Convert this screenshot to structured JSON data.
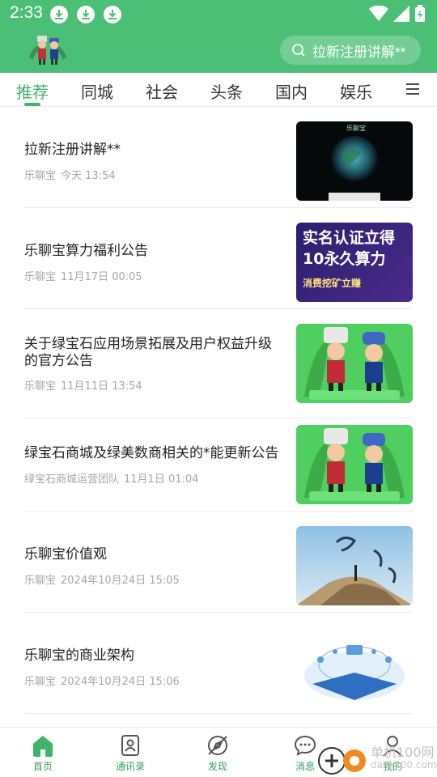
{
  "status_bar": {
    "time": "2:33",
    "notification_icons": [
      "download-icon",
      "download-icon",
      "download-icon"
    ],
    "system_icons": [
      "wifi-icon",
      "signal-icon",
      "battery-charging-icon"
    ]
  },
  "header": {
    "logo": "mascot-logo",
    "search_placeholder": "拉新注册讲解**"
  },
  "tabs": {
    "items": [
      {
        "label": "推荐",
        "active": true
      },
      {
        "label": "同城"
      },
      {
        "label": "社会"
      },
      {
        "label": "头条"
      },
      {
        "label": "国内"
      },
      {
        "label": "娱乐"
      }
    ],
    "menu_icon": "hamburger-icon"
  },
  "articles": [
    {
      "title": "拉新注册讲解**",
      "source": "乐聊宝",
      "time": "今天 13:54",
      "thumb": "earth-poster",
      "thumb_text": "乐聊宝"
    },
    {
      "title": "乐聊宝算力福利公告",
      "source": "乐聊宝",
      "time": "11月17日 00:05",
      "thumb": "promo-banner",
      "thumb_line1": "实名认证立得",
      "thumb_line2": "10永久算力",
      "thumb_line3": "消费挖矿立赚"
    },
    {
      "title": "关于绿宝石应用场景拓展及用户权益升级的官方公告",
      "source": "乐聊宝",
      "time": "11月11日 13:54",
      "thumb": "mascots"
    },
    {
      "title": "绿宝石商城及绿美数商相关的*能更新公告",
      "source": "绿宝石商城运营团队",
      "time": "11月1日 01:04",
      "thumb": "mascots"
    },
    {
      "title": "乐聊宝价值观",
      "source": "乐聊宝",
      "time": "2024年10月24日 15:05",
      "thumb": "mountain-calligraphy"
    },
    {
      "title": "乐聊宝的商业架构",
      "source": "乐聊宝",
      "time": "2024年10月24日 15:06",
      "thumb": "architecture-diagram"
    }
  ],
  "bottom_nav": [
    {
      "label": "首页",
      "icon": "home-icon",
      "active": true
    },
    {
      "label": "通讯录",
      "icon": "contacts-icon"
    },
    {
      "label": "发现",
      "icon": "compass-icon"
    },
    {
      "label": "消息",
      "icon": "chat-icon"
    },
    {
      "label": "我的",
      "icon": "user-icon"
    }
  ],
  "watermark": {
    "text": "单机100网",
    "sub": "danji100.com"
  },
  "colors": {
    "brand_green": "#4cbf76",
    "active_green": "#3fb36a",
    "meta_gray": "#a7a7a7"
  }
}
